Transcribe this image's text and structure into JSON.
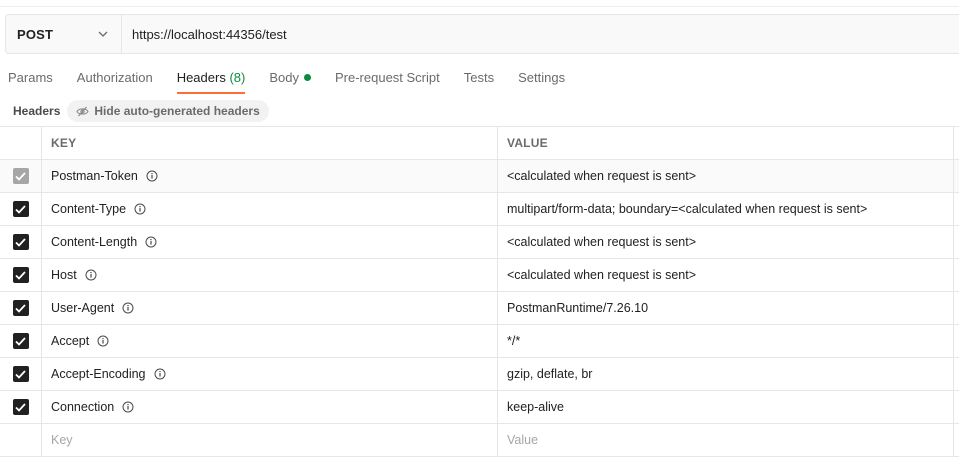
{
  "request": {
    "method": "POST",
    "url": "https://localhost:44356/test"
  },
  "tabs": [
    {
      "label": "Params"
    },
    {
      "label": "Authorization"
    },
    {
      "label": "Headers",
      "count": "(8)",
      "active": true
    },
    {
      "label": "Body",
      "dot": true
    },
    {
      "label": "Pre-request Script"
    },
    {
      "label": "Tests"
    },
    {
      "label": "Settings"
    }
  ],
  "headers_section": {
    "title": "Headers",
    "hide_button_label": "Hide auto-generated headers"
  },
  "table": {
    "key_header": "KEY",
    "value_header": "VALUE",
    "rows": [
      {
        "key": "Postman-Token",
        "value": "<calculated when request is sent>",
        "checked": true,
        "disabled": true
      },
      {
        "key": "Content-Type",
        "value": "multipart/form-data; boundary=<calculated when request is sent>",
        "checked": true
      },
      {
        "key": "Content-Length",
        "value": "<calculated when request is sent>",
        "checked": true
      },
      {
        "key": "Host",
        "value": "<calculated when request is sent>",
        "checked": true
      },
      {
        "key": "User-Agent",
        "value": "PostmanRuntime/7.26.10",
        "checked": true
      },
      {
        "key": "Accept",
        "value": "*/*",
        "checked": true
      },
      {
        "key": "Accept-Encoding",
        "value": "gzip, deflate, br",
        "checked": true
      },
      {
        "key": "Connection",
        "value": "keep-alive",
        "checked": true
      }
    ],
    "key_placeholder": "Key",
    "value_placeholder": "Value"
  },
  "colors": {
    "accent": "#ff6c37",
    "success": "#0c8a3f"
  },
  "icons": {
    "method_dropdown": "chevron-down-icon",
    "hide_button": "eye-slash-icon",
    "info": "info-icon",
    "check": "check-icon"
  }
}
